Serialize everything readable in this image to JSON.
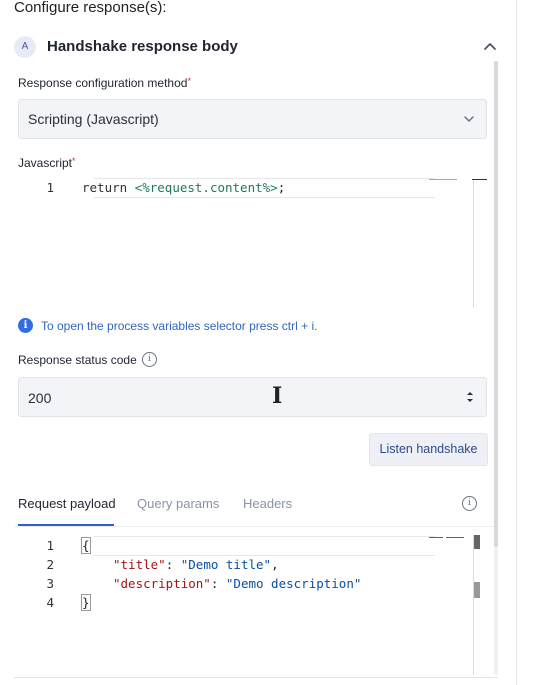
{
  "page": {
    "heading": "Configure response(s):"
  },
  "section": {
    "badge": "A",
    "title": "Handshake response body"
  },
  "response_method": {
    "label": "Response configuration method",
    "required_mark": "*",
    "value": "Scripting (Javascript)"
  },
  "javascript": {
    "label": "Javascript",
    "required_mark": "*",
    "lines": [
      {
        "num": "1",
        "keyword": "return",
        "template": "<%request.content%>",
        "end": ";"
      }
    ]
  },
  "hint": {
    "icon": "i",
    "text": "To open the process variables selector press ctrl + i."
  },
  "status_code": {
    "label": "Response status code",
    "help_icon": "i",
    "value": "200",
    "cursor_glyph": "I"
  },
  "listen_button": {
    "label": "Listen handshake"
  },
  "tabs": {
    "items": [
      "Request payload",
      "Query params",
      "Headers"
    ],
    "active": "Request payload",
    "help_icon": "i"
  },
  "payload_editor": {
    "line_numbers": [
      "1",
      "2",
      "3",
      "4"
    ],
    "open_brace": "{",
    "close_brace": "}",
    "entries": [
      {
        "key": "\"title\"",
        "sep": ": ",
        "value": "\"Demo title\"",
        "end": ","
      },
      {
        "key": "\"description\"",
        "sep": ": ",
        "value": "\"Demo description\"",
        "end": ""
      }
    ]
  },
  "colors": {
    "accent": "#2f5fce",
    "info": "#2f6ee4",
    "field_bg": "#f3f4f7"
  }
}
